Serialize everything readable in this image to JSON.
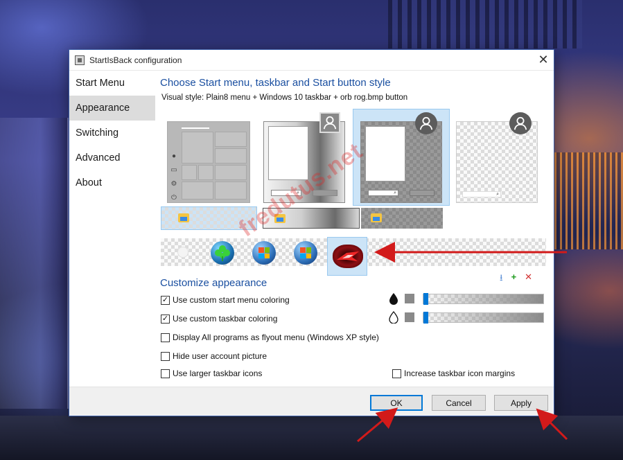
{
  "window": {
    "title": "StartIsBack configuration",
    "close_glyph": "✕"
  },
  "sidebar": {
    "items": [
      {
        "label": "Start Menu"
      },
      {
        "label": "Appearance"
      },
      {
        "label": "Switching"
      },
      {
        "label": "Advanced"
      },
      {
        "label": "About"
      }
    ],
    "selected": "Appearance"
  },
  "main": {
    "style_heading": "Choose Start menu, taskbar and Start button style",
    "visual_style": "Visual style:  Plain8 menu + Windows 10 taskbar + orb rog.bmp button",
    "customize_heading": "Customize appearance",
    "orb_tools": {
      "download": "⭳",
      "add": "+",
      "remove": "✕"
    },
    "options": [
      {
        "label": "Use custom start menu coloring",
        "checked": true
      },
      {
        "label": "Use custom taskbar coloring",
        "checked": true
      },
      {
        "label": "Display All programs as flyout menu (Windows XP style)",
        "checked": false
      },
      {
        "label": "Hide user account picture",
        "checked": false
      },
      {
        "label": "Use larger taskbar icons",
        "checked": false
      },
      {
        "label": "Increase taskbar icon margins",
        "checked": false
      }
    ],
    "sliders": [
      {
        "icon": "filled-drop-icon",
        "swatch_color": "#8a8a8a",
        "value": 0
      },
      {
        "icon": "outline-drop-icon",
        "swatch_color": "#8a8a8a",
        "value": 0
      }
    ]
  },
  "footer": {
    "ok": "OK",
    "cancel": "Cancel",
    "apply": "Apply"
  },
  "watermark": "fredutus.net",
  "colors": {
    "accent": "#0078d7",
    "heading": "#1a4fa0",
    "selection": "#cce4f7",
    "arrow": "#d21a1a"
  }
}
